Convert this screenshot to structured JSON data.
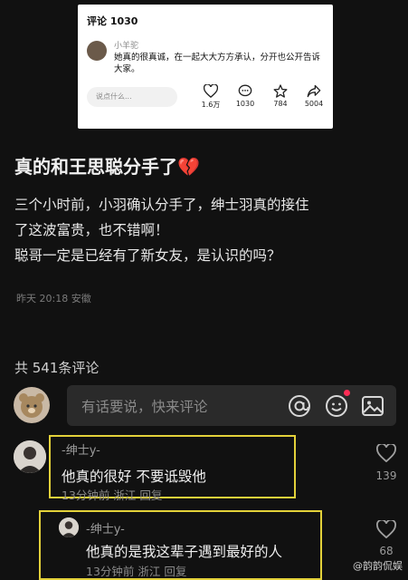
{
  "card": {
    "title": "评论 1030",
    "username": "小羊驼",
    "text": "她真的很真诚，在一起大大方方承认，分开也公开告诉大家。",
    "input_placeholder": "说点什么...",
    "stats": [
      {
        "icon": "heart-icon",
        "value": "1.6万"
      },
      {
        "icon": "comment-icon",
        "value": "1030"
      },
      {
        "icon": "star-icon",
        "value": "784"
      },
      {
        "icon": "share-icon",
        "value": "5004"
      }
    ]
  },
  "post": {
    "title": "真的和王思聪分手了",
    "title_emoji": "💔",
    "body_lines": [
      "三个小时前，小羽确认分手了，绅士羽真的接住",
      "了这波富贵，也不错啊！",
      "聪哥一定是已经有了新女友，是认识的吗？"
    ],
    "meta": "昨天 20:18 安徽"
  },
  "comments_header": "共 541条评论",
  "input": {
    "placeholder": "有话要说，快来评论",
    "icons": [
      "at-icon",
      "emoji-icon",
      "image-icon"
    ],
    "accent": "#ff2d55"
  },
  "comments": [
    {
      "name": "-绅士y-",
      "text": "他真的很好 不要诋毁他",
      "meta": "13分钟前  浙江  回复",
      "likes": "139"
    },
    {
      "name": "-绅士y-",
      "text": "他真的是我这辈子遇到最好的人",
      "meta": "13分钟前  浙江  回复",
      "likes": "68"
    }
  ],
  "watermark": "@韵韵侃娱",
  "highlight_color": "#e3d13a"
}
